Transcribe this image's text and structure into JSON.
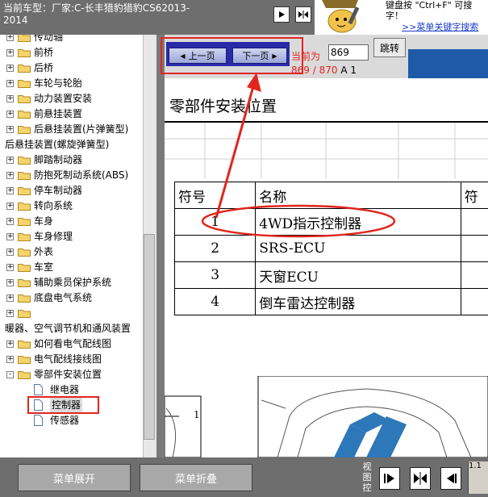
{
  "header": {
    "vehicle_line1": "当前车型：厂家:C-长丰猎豹猎豹CS62013-",
    "vehicle_line2": "2014",
    "hint_line1": "键盘按 \"Ctrl+F\" 可搜",
    "hint_line2": "字！",
    "hint_link": ">>菜单关键字搜索"
  },
  "sidebar": {
    "items": [
      {
        "label": "传动轴",
        "expander": "+",
        "kind": "folder",
        "indent": 0
      },
      {
        "label": "前桥",
        "expander": "+",
        "kind": "folder",
        "indent": 0
      },
      {
        "label": "后桥",
        "expander": "+",
        "kind": "folder",
        "indent": 0
      },
      {
        "label": "车轮与轮胎",
        "expander": "+",
        "kind": "folder",
        "indent": 0
      },
      {
        "label": "动力装置安装",
        "expander": "+",
        "kind": "folder",
        "indent": 0
      },
      {
        "label": "前悬挂装置",
        "expander": "+",
        "kind": "folder",
        "indent": 0
      },
      {
        "label": "后悬挂装置(片弹簧型)",
        "expander": "+",
        "kind": "folder",
        "indent": 0
      },
      {
        "label": "后悬挂装置(螺旋弹簧型)",
        "expander": "",
        "kind": "text",
        "indent": 0
      },
      {
        "label": "脚踏制动器",
        "expander": "+",
        "kind": "folder",
        "indent": 0
      },
      {
        "label": "防抱死制动系统(ABS)",
        "expander": "+",
        "kind": "folder",
        "indent": 0
      },
      {
        "label": "停车制动器",
        "expander": "+",
        "kind": "folder",
        "indent": 0
      },
      {
        "label": "转向系统",
        "expander": "+",
        "kind": "folder",
        "indent": 0
      },
      {
        "label": "车身",
        "expander": "+",
        "kind": "folder",
        "indent": 0
      },
      {
        "label": "车身修理",
        "expander": "+",
        "kind": "folder",
        "indent": 0
      },
      {
        "label": "外表",
        "expander": "+",
        "kind": "folder",
        "indent": 0
      },
      {
        "label": "车室",
        "expander": "+",
        "kind": "folder",
        "indent": 0
      },
      {
        "label": "辅助乘员保护系统",
        "expander": "+",
        "kind": "folder",
        "indent": 0
      },
      {
        "label": "底盘电气系统",
        "expander": "+",
        "kind": "folder",
        "indent": 0
      },
      {
        "label": "",
        "expander": "+",
        "kind": "folder",
        "indent": 0
      },
      {
        "label": "暖器、空气调节机和通风装置",
        "expander": "",
        "kind": "text",
        "indent": 0
      },
      {
        "label": "如何看电气配线图",
        "expander": "+",
        "kind": "folder",
        "indent": 0
      },
      {
        "label": "电气配线接线图",
        "expander": "+",
        "kind": "folder",
        "indent": 0
      },
      {
        "label": "零部件安装位置",
        "expander": "-",
        "kind": "folder-open",
        "indent": 0
      },
      {
        "label": "继电器",
        "expander": "",
        "kind": "doc",
        "indent": 1
      },
      {
        "label": "控制器",
        "expander": "",
        "kind": "doc-selected",
        "indent": 1
      },
      {
        "label": "传感器",
        "expander": "",
        "kind": "doc",
        "indent": 1
      }
    ]
  },
  "pager": {
    "prev_label": "上一页",
    "next_label": "下一页",
    "current_label": "当前为",
    "page_value": "869",
    "jump_label": "跳转",
    "page_current": "869",
    "page_sep": "/",
    "page_total": "870",
    "page_suffix": "A 1"
  },
  "document": {
    "title": "零部件安装位置",
    "table_headers": [
      "符号",
      "名称",
      "符"
    ],
    "rows": [
      {
        "num": "1",
        "name": "4WD指示控制器"
      },
      {
        "num": "2",
        "name": "SRS-ECU"
      },
      {
        "num": "3",
        "name": "天窗ECU"
      },
      {
        "num": "4",
        "name": "倒车雷达控制器"
      }
    ],
    "diagram_callout": "1"
  },
  "footer": {
    "expand_label": "菜单展开",
    "collapse_label": "菜单折叠",
    "side_label_1": "视",
    "side_label_2": "图",
    "side_label_3": "控",
    "corner_text": "1.1"
  },
  "colors": {
    "highlight_red": "#e0261e",
    "page_blue": "#1e5aa8"
  }
}
